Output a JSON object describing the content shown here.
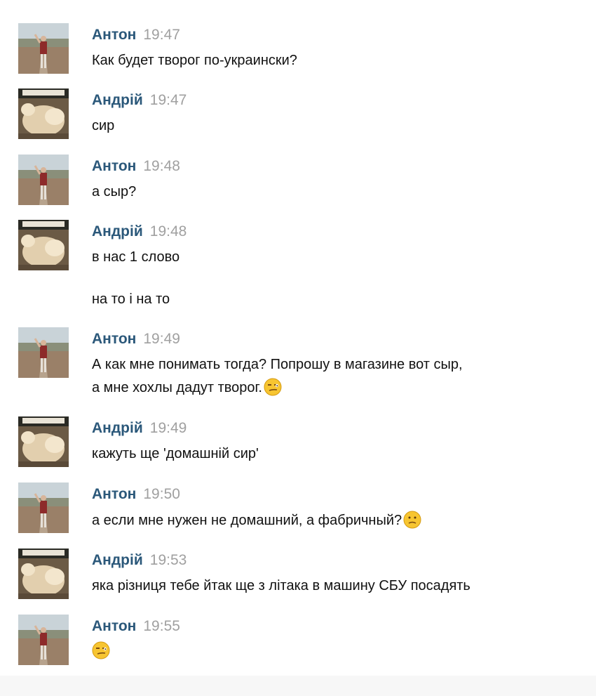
{
  "colors": {
    "name": "#2b587a",
    "time": "#a0a0a0",
    "text": "#111111",
    "emoji_face": "#f7c531"
  },
  "messages": [
    {
      "name": "Антон",
      "time": "19:47",
      "avatar": "anton-avatar",
      "lines": [
        "Как будет творог по-украински?"
      ]
    },
    {
      "name": "Андрій",
      "time": "19:47",
      "avatar": "andrii-avatar",
      "lines": [
        "сир"
      ]
    },
    {
      "name": "Антон",
      "time": "19:48",
      "avatar": "anton-avatar",
      "lines": [
        "а сыр?"
      ]
    },
    {
      "name": "Андрій",
      "time": "19:48",
      "avatar": "andrii-avatar",
      "lines": [
        "в нас 1 слово",
        "на то і на то"
      ]
    },
    {
      "name": "Антон",
      "time": "19:49",
      "avatar": "anton-avatar",
      "lines": [
        "А как мне понимать тогда? Попрошу в магазине вот сыр,",
        "а мне хохлы дадут творог."
      ],
      "emoji": "smirk-emoji"
    },
    {
      "name": "Андрій",
      "time": "19:49",
      "avatar": "andrii-avatar",
      "lines": [
        "кажуть ще 'домашній сир'"
      ]
    },
    {
      "name": "Антон",
      "time": "19:50",
      "avatar": "anton-avatar",
      "lines": [
        "а если мне нужен не домашний, а фабричный?"
      ],
      "emoji": "confused-emoji"
    },
    {
      "name": "Андрій",
      "time": "19:53",
      "avatar": "andrii-avatar",
      "lines": [
        "яка різниця тебе йтак ще з літака в машину СБУ посадять"
      ]
    },
    {
      "name": "Антон",
      "time": "19:55",
      "avatar": "anton-avatar",
      "lines": [
        ""
      ],
      "emoji": "smirk-emoji"
    }
  ]
}
